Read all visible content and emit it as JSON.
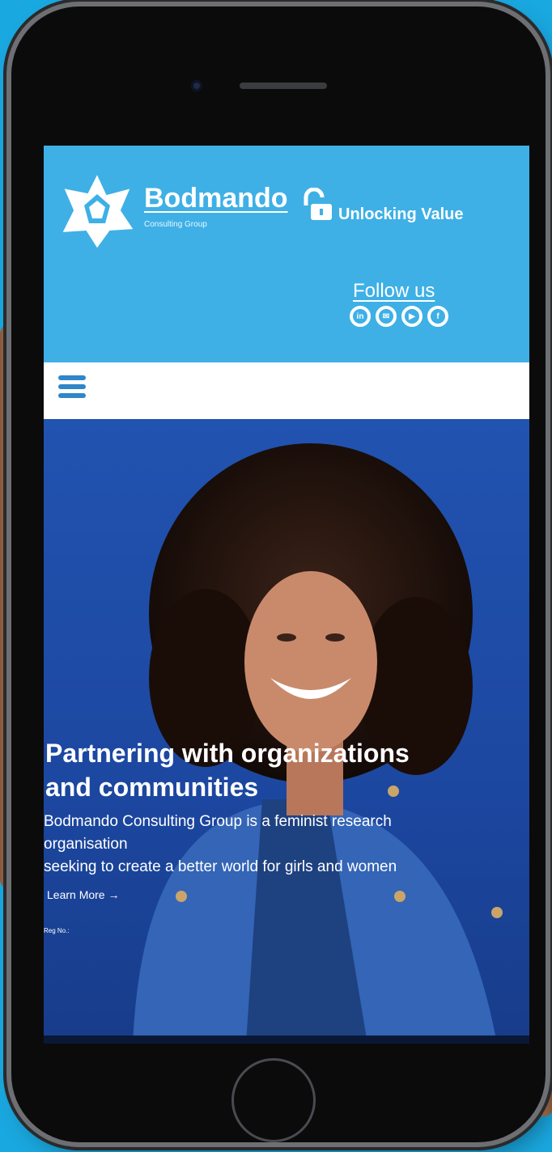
{
  "header": {
    "brand_name": "Bodmando",
    "brand_subtitle": "Consulting Group",
    "tagline": "Unlocking Value",
    "follow_label": "Follow us",
    "social_icons": [
      "linkedin-icon",
      "email-icon",
      "youtube-icon",
      "facebook-icon"
    ]
  },
  "nav": {
    "menu_icon": "hamburger-menu-icon"
  },
  "hero": {
    "title_line1": "Partnering with organizations",
    "title_line2": "and communities",
    "body_line1": "Bodmando Consulting Group is a feminist research",
    "body_line2": "organisation",
    "body_line3": "seeking to create a better world for girls and women",
    "learn_more": "Learn More",
    "reg_label": "Reg No.:"
  },
  "colors": {
    "page_background": "#1aa8e0",
    "header_band": "#3eb0e6",
    "nav_background": "#ffffff",
    "hero_background": "#1d4fae",
    "menu_icon": "#2f86c9"
  }
}
